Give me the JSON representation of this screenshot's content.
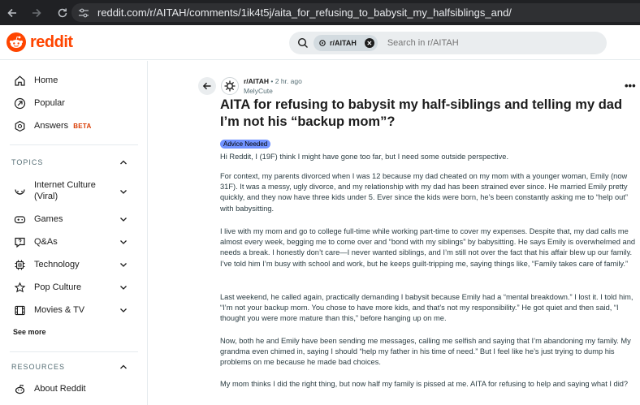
{
  "browser": {
    "url_host": "reddit.com",
    "url_path": "/r/AITAH/comments/1ik4t5j/aita_for_refusing_to_babysit_my_halfsiblings_and/"
  },
  "header": {
    "logo_text": "reddit",
    "search_chip": "r/AITAH",
    "search_placeholder": "Search in r/AITAH"
  },
  "sidebar": {
    "home": "Home",
    "popular": "Popular",
    "answers": "Answers",
    "beta": "BETA",
    "topics_heading": "TOPICS",
    "topics": [
      {
        "label1": "Internet Culture",
        "label2": "(Viral)"
      },
      {
        "label1": "Games"
      },
      {
        "label1": "Q&As"
      },
      {
        "label1": "Technology"
      },
      {
        "label1": "Pop Culture"
      },
      {
        "label1": "Movies & TV"
      }
    ],
    "see_more": "See more",
    "resources_heading": "RESOURCES",
    "about": "About Reddit"
  },
  "post": {
    "subreddit": "r/AITAH",
    "time": "2 hr. ago",
    "author": "MelyCute",
    "title": "AITA for refusing to babysit my half-siblings and telling my dad I’m not his “backup mom”?",
    "flair": "Advice Needed",
    "flair_color": "#7193ff",
    "paragraphs": [
      "Hi Reddit, I (19F) think I might have gone too far, but I need some outside perspective.",
      "For context, my parents divorced when I was 12 because my dad cheated on my mom with a younger woman, Emily (now 31F). It was a messy, ugly divorce, and my relationship with my dad has been strained ever since. He married Emily pretty quickly, and they now have three kids under 5. Ever since the kids were born, he’s been constantly asking me to “help out” with babysitting.",
      "I live with my mom and go to college full-time while working part-time to cover my expenses. Despite that, my dad calls me almost every week, begging me to come over and “bond with my siblings” by babysitting. He says Emily is overwhelmed and needs a break. I honestly don’t care—I never wanted siblings, and I’m still not over the fact that his affair blew up our family. I’ve told him I’m busy with school and work, but he keeps guilt-tripping me, saying things like, “Family takes care of family.”",
      "Last weekend, he called again, practically demanding I babysit because Emily had a “mental breakdown.” I lost it. I told him, “I’m not your backup mom. You chose to have more kids, and that’s not my responsibility.” He got quiet and then said, “I thought you were more mature than this,” before hanging up on me.",
      "Now, both he and Emily have been sending me messages, calling me selfish and saying that I’m abandoning my family. My grandma even chimed in, saying I should “help my father in his time of need.” But I feel like he’s just trying to dump his problems on me because he made bad choices.",
      "My mom thinks I did the right thing, but now half my family is pissed at me. AITA for refusing to help and saying what I did?"
    ]
  }
}
